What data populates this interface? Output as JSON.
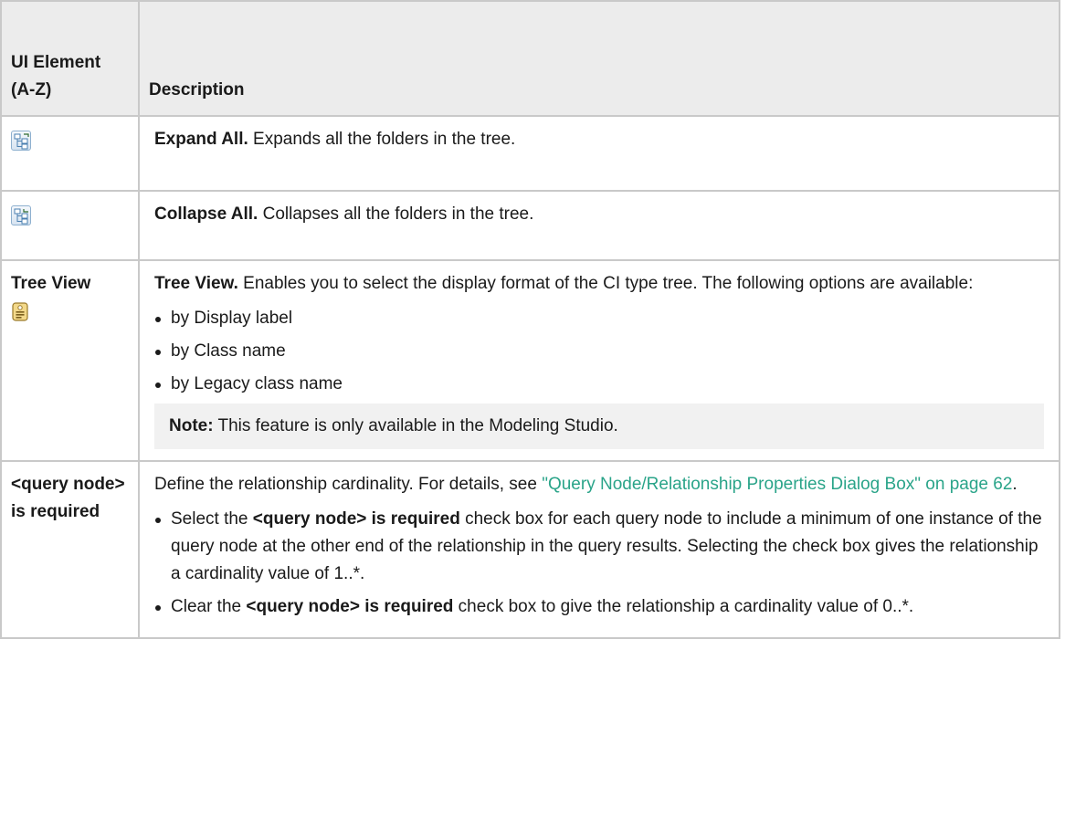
{
  "header": {
    "col1": "UI Element (A-Z)",
    "col2": "Description"
  },
  "rows": {
    "expand": {
      "icon": "expand-all-icon",
      "title": "Expand All.",
      "text": " Expands all the folders in the tree."
    },
    "collapse": {
      "icon": "collapse-all-icon",
      "title": "Collapse All.",
      "text": " Collapses all the folders in the tree."
    },
    "tree_view": {
      "element": "Tree View",
      "icon": "tree-view-tag-icon",
      "title": "Tree View.",
      "text": " Enables you to select the display format of the CI type tree. The following options are available:",
      "options": [
        "by Display label",
        "by Class name",
        "by Legacy class name"
      ],
      "note_label": "Note:",
      "note_text": " This feature is only available in the Modeling Studio."
    },
    "required": {
      "element": "<query node> is required",
      "intro_text": "Define the relationship cardinality. For details, see ",
      "link_text": "\"Query Node/Relationship Properties Dialog Box\" on page 62",
      "intro_end": ".",
      "bullet1_pre": "Select the ",
      "bullet1_bold": "<query node> is required",
      "bullet1_post": " check box for each query node to include a minimum of one instance of the query node at the other end of the relationship in the query results. Selecting the check box gives the relationship a cardinality value of 1..*.",
      "bullet2_pre": "Clear the ",
      "bullet2_bold": "<query node> is required",
      "bullet2_post": " check box to give the relationship a cardinality value of 0..*."
    }
  },
  "colors": {
    "link": "#2aa489",
    "header_bg": "#ececec",
    "border": "#c9c9c9"
  }
}
